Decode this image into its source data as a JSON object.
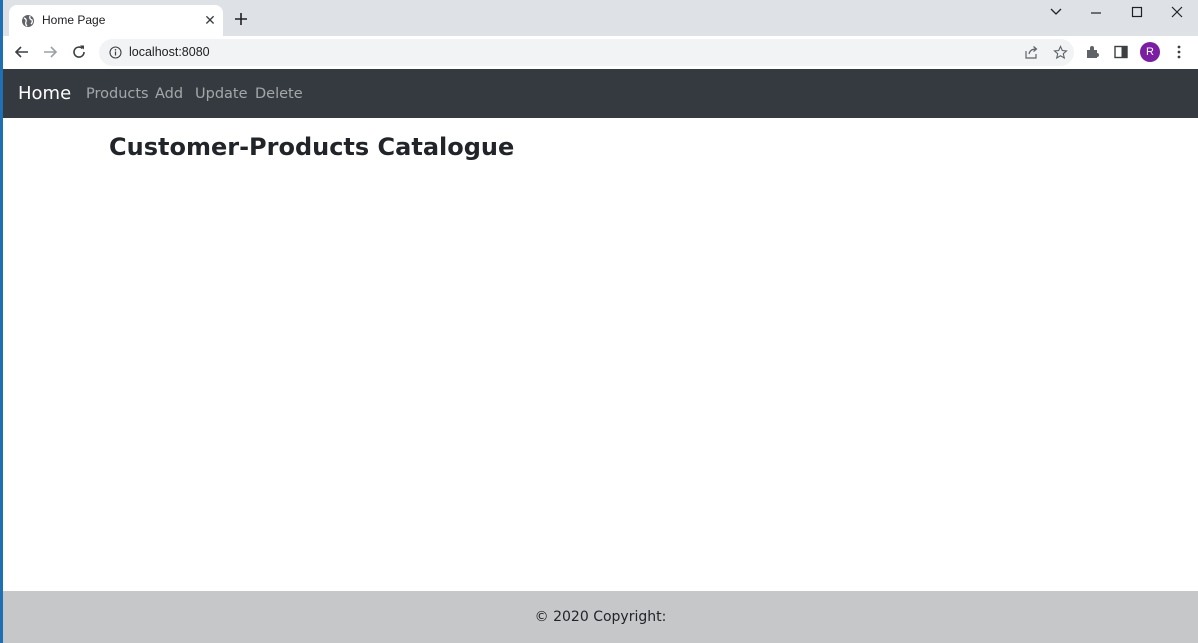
{
  "browser": {
    "tab": {
      "title": "Home Page",
      "close_glyph": "✕"
    },
    "address_bar": {
      "url": "localhost:8080"
    },
    "profile": {
      "initial": "R",
      "color": "#7b1fa2"
    }
  },
  "page": {
    "navbar": {
      "brand": "Home",
      "links": [
        "Products",
        "Add",
        "Update",
        "Delete"
      ]
    },
    "heading": "Customer-Products Catalogue",
    "footer": "© 2020 Copyright:"
  },
  "colors": {
    "navbar_bg": "#343a40",
    "footer_bg": "#c6c7c9",
    "heading": "#212529"
  }
}
